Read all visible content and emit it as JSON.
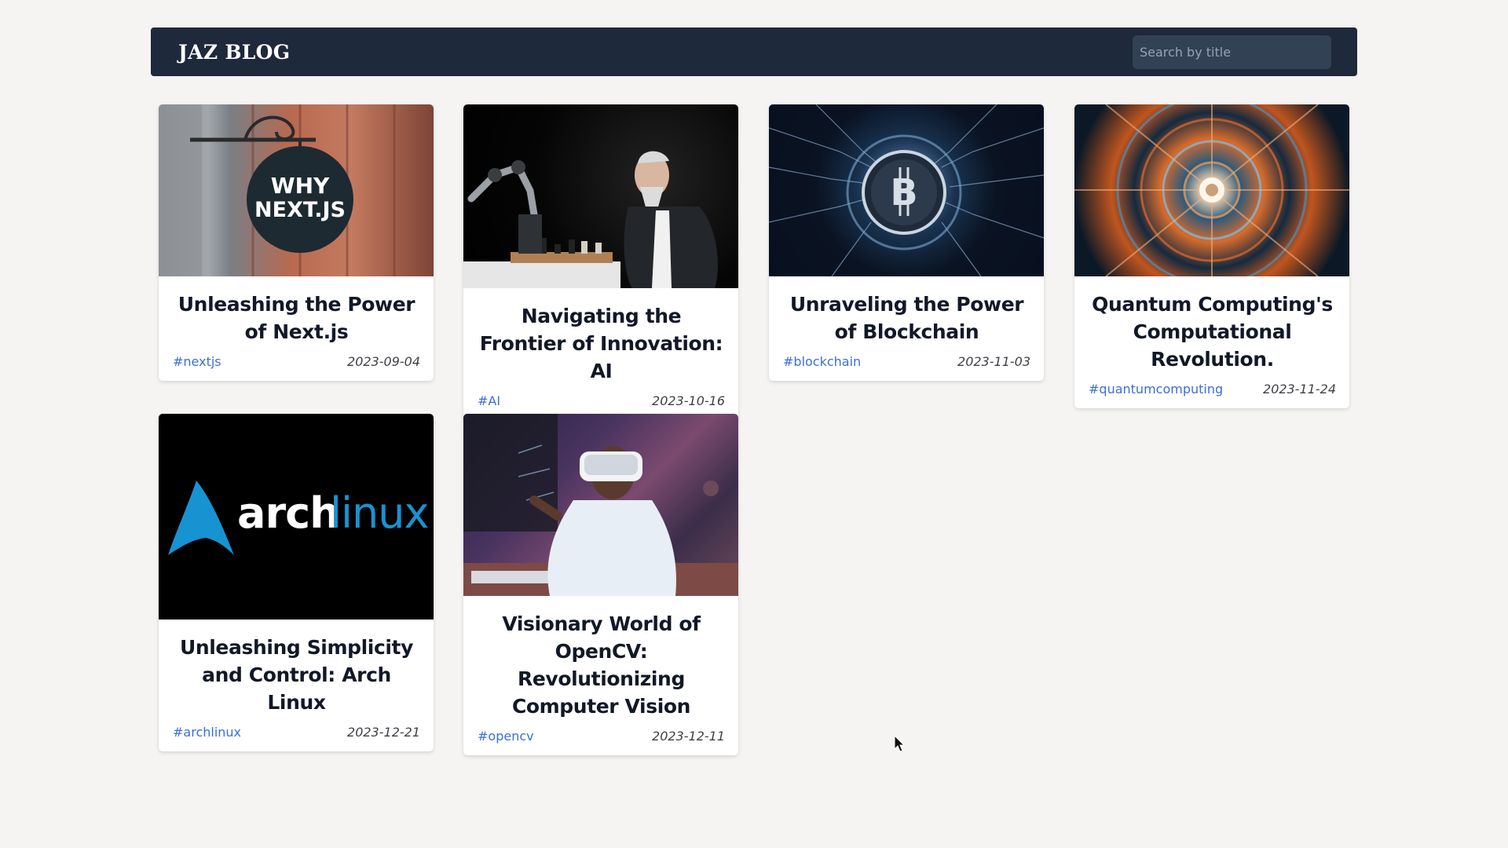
{
  "header": {
    "logo": "JAZ BLOG",
    "search_placeholder": "Search by title"
  },
  "posts": [
    {
      "title": "Unleashing the Power of Next.js",
      "tag": "#nextjs",
      "date": "2023-09-04",
      "image_text": "WHY NEXT.JS"
    },
    {
      "title": "Navigating the Frontier of Innovation: AI",
      "tag": "#AI",
      "date": "2023-10-16"
    },
    {
      "title": "Unraveling the Power of Blockchain",
      "tag": "#blockchain",
      "date": "2023-11-03"
    },
    {
      "title": "Quantum Computing's Computational Revolution.",
      "tag": "#quantumcomputing",
      "date": "2023-11-24"
    },
    {
      "title": "Unleashing Simplicity and Control: Arch Linux",
      "tag": "#archlinux",
      "date": "2023-12-21",
      "image_text": "archlinux"
    },
    {
      "title": "Visionary World of OpenCV: Revolutionizing Computer Vision",
      "tag": "#opencv",
      "date": "2023-12-11"
    }
  ],
  "colors": {
    "header_bg": "#1e293b",
    "page_bg": "#f5f4f2",
    "tag": "#3b6fd6",
    "arch_blue": "#1793d1"
  }
}
